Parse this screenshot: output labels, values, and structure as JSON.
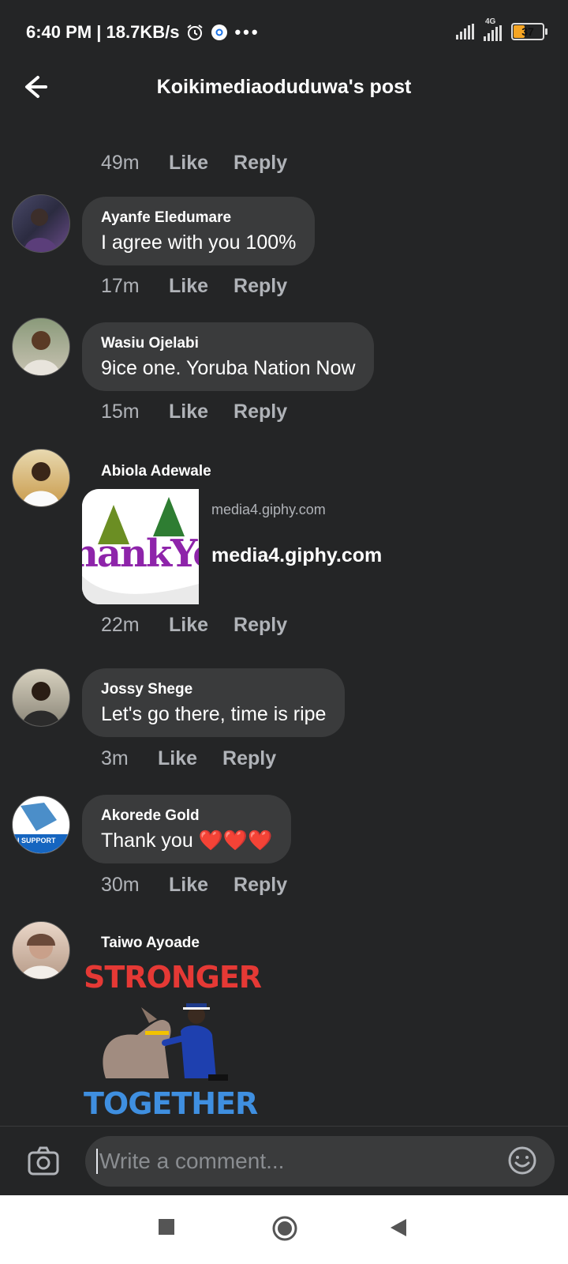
{
  "status": {
    "time_speed": "6:40 PM | 18.7KB/s",
    "network": "4G",
    "battery": "37",
    "icons": [
      "alarm-icon",
      "chrome-icon",
      "more-icon",
      "signal-icon",
      "battery-icon"
    ]
  },
  "header": {
    "title": "Koikimediaoduduwa's post"
  },
  "actions": {
    "like": "Like",
    "reply": "Reply"
  },
  "comments": [
    {
      "time": "49m"
    },
    {
      "name": "Ayanfe Eledumare",
      "text": "I agree with you 100%",
      "time": "17m"
    },
    {
      "name": "Wasiu Ojelabi",
      "text": "9ice one. Yoruba Nation Now",
      "time": "15m"
    },
    {
      "name": "Abiola Adewale",
      "link_domain": "media4.giphy.com",
      "link_title": "media4.giphy.com",
      "gif_text": "hankYo",
      "time": "22m"
    },
    {
      "name": "Jossy Shege",
      "text": "Let's go there, time is ripe",
      "time": "3m"
    },
    {
      "name": "Akorede Gold",
      "text": "Thank you ❤️❤️❤️",
      "avatar_text": "I SUPPORT",
      "time": "30m"
    },
    {
      "name": "Taiwo Ayoade",
      "sticker_top": "STRONGER",
      "sticker_bottom": "TOGETHER"
    }
  ],
  "composer": {
    "placeholder": "Write a comment..."
  },
  "colors": {
    "background": "#242526",
    "bubble": "#3a3b3c",
    "meta": "#b0b3b8"
  }
}
